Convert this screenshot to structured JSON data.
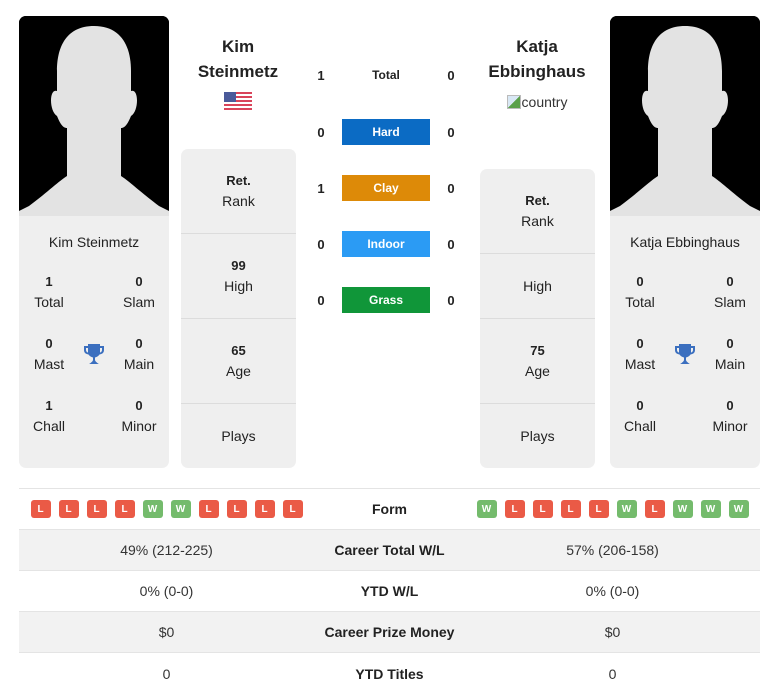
{
  "colors": {
    "hard": "#0b6bc4",
    "clay": "#dd8a08",
    "indoor": "#2b9bf4",
    "grass": "#109639",
    "trophy": "#3b6fbf",
    "win": "#74bb6c",
    "loss": "#ea5a46"
  },
  "player1": {
    "name": "Kim Steinmetz",
    "name_line1": "Kim",
    "name_line2": "Steinmetz",
    "country_icon": "us-flag-icon",
    "titles": {
      "total": {
        "value": "1",
        "label": "Total"
      },
      "slam": {
        "value": "0",
        "label": "Slam"
      },
      "mast": {
        "value": "0",
        "label": "Mast"
      },
      "main": {
        "value": "0",
        "label": "Main"
      },
      "chall": {
        "value": "1",
        "label": "Chall"
      },
      "minor": {
        "value": "0",
        "label": "Minor"
      }
    },
    "info": {
      "rank": {
        "value": "Ret.",
        "label": "Rank"
      },
      "high": {
        "value": "99",
        "label": "High"
      },
      "age": {
        "value": "65",
        "label": "Age"
      },
      "plays": {
        "value": "",
        "label": "Plays"
      }
    },
    "form": [
      "L",
      "L",
      "L",
      "L",
      "W",
      "W",
      "L",
      "L",
      "L",
      "L"
    ]
  },
  "player2": {
    "name": "Katja Ebbinghaus",
    "name_line1": "Katja",
    "name_line2": "Ebbinghaus",
    "country_alt": "country",
    "titles": {
      "total": {
        "value": "0",
        "label": "Total"
      },
      "slam": {
        "value": "0",
        "label": "Slam"
      },
      "mast": {
        "value": "0",
        "label": "Mast"
      },
      "main": {
        "value": "0",
        "label": "Main"
      },
      "chall": {
        "value": "0",
        "label": "Chall"
      },
      "minor": {
        "value": "0",
        "label": "Minor"
      }
    },
    "info": {
      "rank": {
        "value": "Ret.",
        "label": "Rank"
      },
      "high": {
        "value": "",
        "label": "High"
      },
      "age": {
        "value": "75",
        "label": "Age"
      },
      "plays": {
        "value": "",
        "label": "Plays"
      }
    },
    "form": [
      "W",
      "L",
      "L",
      "L",
      "L",
      "W",
      "L",
      "W",
      "W",
      "W"
    ]
  },
  "h2h": {
    "total": {
      "label": "Total",
      "p1": "1",
      "p2": "0"
    },
    "surfaces": [
      {
        "label": "Hard",
        "p1": "0",
        "p2": "0",
        "color": "#0b6bc4"
      },
      {
        "label": "Clay",
        "p1": "1",
        "p2": "0",
        "color": "#dd8a08"
      },
      {
        "label": "Indoor",
        "p1": "0",
        "p2": "0",
        "color": "#2b9bf4"
      },
      {
        "label": "Grass",
        "p1": "0",
        "p2": "0",
        "color": "#109639"
      }
    ]
  },
  "stats": {
    "form_label": "Form",
    "rows": [
      {
        "label": "Career Total W/L",
        "p1": "49% (212-225)",
        "p2": "57% (206-158)"
      },
      {
        "label": "YTD W/L",
        "p1": "0% (0-0)",
        "p2": "0% (0-0)"
      },
      {
        "label": "Career Prize Money",
        "p1": "$0",
        "p2": "$0"
      },
      {
        "label": "YTD Titles",
        "p1": "0",
        "p2": "0"
      }
    ]
  }
}
